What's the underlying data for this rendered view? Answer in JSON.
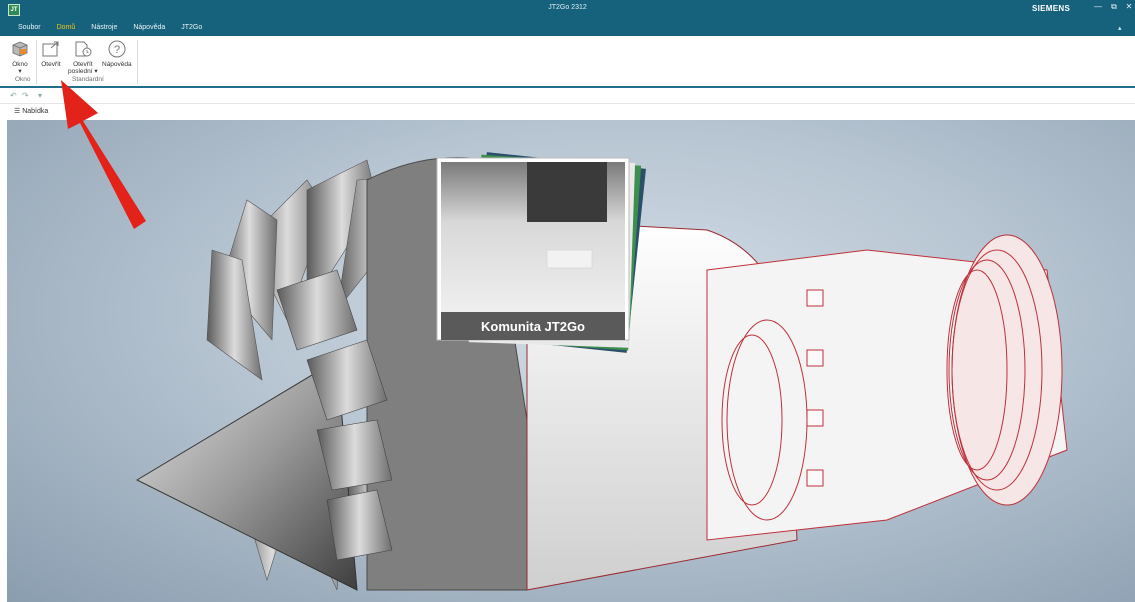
{
  "window": {
    "title": "JT2Go 2312",
    "brand": "SIEMENS",
    "app_icon": "JT",
    "minimize_glyph": "—",
    "restore_glyph": "⧉",
    "close_glyph": "✕",
    "collapse_glyph": "▴"
  },
  "tabs": [
    {
      "label": "Soubor"
    },
    {
      "label": "Domů"
    },
    {
      "label": "Nástroje"
    },
    {
      "label": "Nápověda"
    },
    {
      "label": "JT2Go"
    }
  ],
  "ribbon": {
    "okno": {
      "label": "Okno",
      "dropdown": "▾"
    },
    "otevrit": {
      "label": "Otevřít"
    },
    "otevrit_posledni": {
      "label_line1": "Otevřít",
      "label_line2": "poslední ▾"
    },
    "napoveda": {
      "label": "Nápověda"
    },
    "groups": {
      "okno": "Okno",
      "standardni": "Standardní"
    }
  },
  "quick_access": {
    "undo": "↶",
    "redo": "↷",
    "customize": "▾"
  },
  "menu_button": {
    "label": "☰ Nabídka"
  },
  "viewport": {
    "card_title": "Komunita JT2Go"
  },
  "colors": {
    "titlebar": "#16627d",
    "active_tab": "#f0c419",
    "arrow": "#e32219",
    "engine_red": "#c0303a"
  }
}
